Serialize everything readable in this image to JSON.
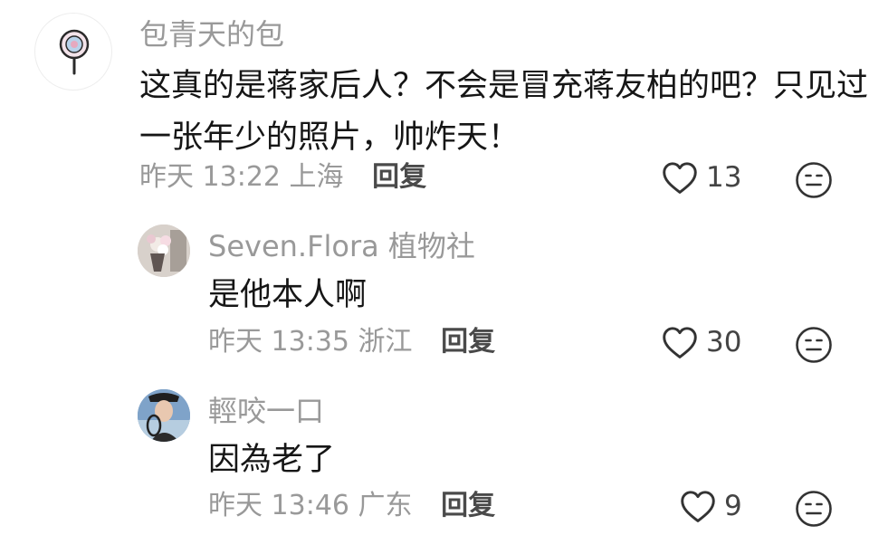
{
  "comments": [
    {
      "username": "包青天的包",
      "text_lines": [
        "这真的是蒋家后人？不会是冒充蒋友柏的吧？只见过",
        "一张年少的照片，帅炸天！"
      ],
      "time": "昨天 13:22",
      "location": "上海",
      "reply_label": "回复",
      "likes": "13",
      "avatar_icon": "lollipop-icon"
    }
  ],
  "replies": [
    {
      "username": "Seven.Flora 植物社",
      "text": "是他本人啊",
      "time": "昨天 13:35",
      "location": "浙江",
      "reply_label": "回复",
      "likes": "30"
    },
    {
      "username": "輕咬一口",
      "text": "因為老了",
      "time": "昨天 13:46",
      "location": "广东",
      "reply_label": "回复",
      "likes": "9"
    }
  ],
  "colors": {
    "meta": "#999999",
    "text": "#161616",
    "icon": "#333333"
  }
}
